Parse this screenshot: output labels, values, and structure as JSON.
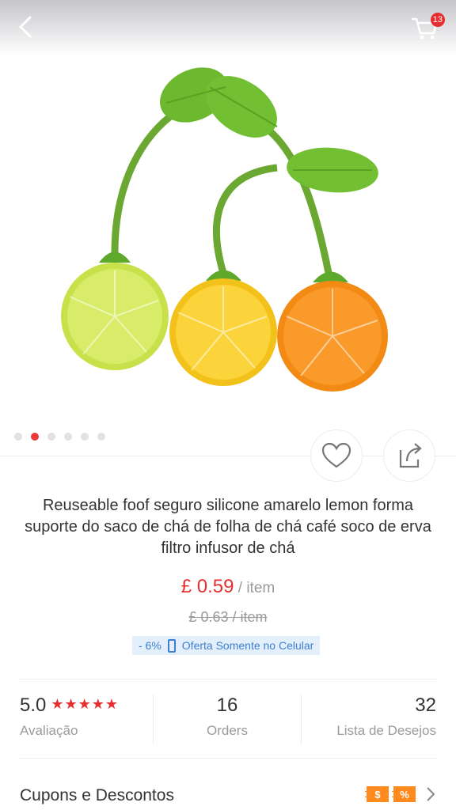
{
  "header": {
    "back_icon": "chevron-left-icon",
    "cart_icon": "cart-icon",
    "cart_count": "13"
  },
  "gallery": {
    "image_subject": "cherry-shaped citrus tea infusers",
    "slide_count": 6,
    "active_slide": 2
  },
  "actions": {
    "wishlist_icon": "heart-icon",
    "share_icon": "share-icon"
  },
  "product": {
    "title": "Reuseable foof seguro silicone amarelo lemon forma suporte do saco de chá de folha de chá café soco de erva filtro infusor de chá",
    "price": "£ 0.59",
    "price_unit": " / item",
    "old_price": "£ 0.63  / item",
    "discount": "- 6%",
    "promo_text": "Oferta Somente no Celular"
  },
  "stats": {
    "rating_value": "5.0",
    "rating_stars": "★★★★★",
    "rating_label": "Avaliação",
    "orders_value": "16",
    "orders_label": "Orders",
    "wishlist_value": "32",
    "wishlist_label": "Lista de Desejos"
  },
  "coupons": {
    "label": "Cupons e Descontos",
    "tag_dollar": "$",
    "tag_percent": "%"
  },
  "colors": {
    "accent_red": "#e62e2e",
    "promo_blue": "#3f7fcf",
    "tag_orange": "#ff8a1f"
  }
}
